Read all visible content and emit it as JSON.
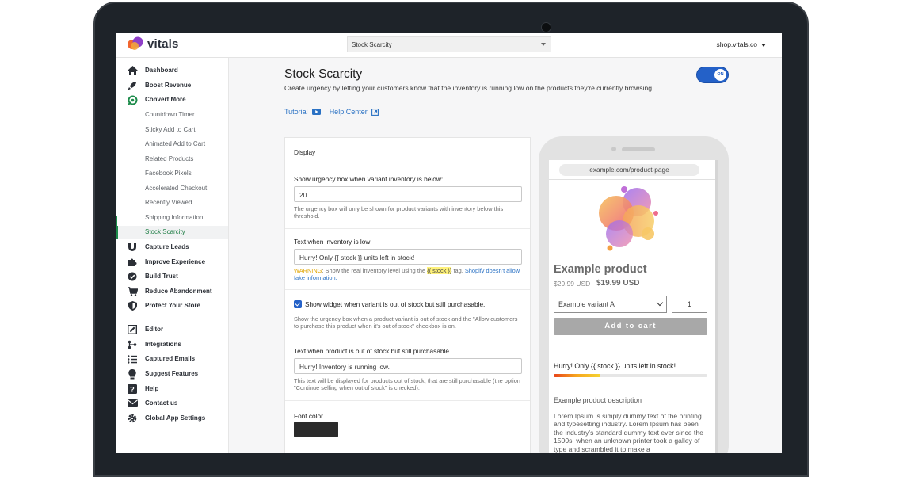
{
  "app": {
    "logo_text": "vitals",
    "page_selector": "Stock Scarcity",
    "store": "shop.vitals.co"
  },
  "sidebar": {
    "items": [
      {
        "label": "Dashboard",
        "icon": "home-icon"
      },
      {
        "label": "Boost Revenue",
        "icon": "rocket-icon"
      },
      {
        "label": "Convert More",
        "icon": "convert-icon"
      },
      {
        "label": "Countdown Timer"
      },
      {
        "label": "Sticky Add to Cart"
      },
      {
        "label": "Animated Add to Cart"
      },
      {
        "label": "Related Products"
      },
      {
        "label": "Facebook Pixels"
      },
      {
        "label": "Accelerated Checkout"
      },
      {
        "label": "Recently Viewed"
      },
      {
        "label": "Shipping Information"
      },
      {
        "label": "Stock Scarcity",
        "active": true
      },
      {
        "label": "Capture Leads",
        "icon": "magnet-icon"
      },
      {
        "label": "Improve Experience",
        "icon": "puzzle-icon"
      },
      {
        "label": "Build Trust",
        "icon": "badge-check-icon"
      },
      {
        "label": "Reduce Abandonment",
        "icon": "cart-icon"
      },
      {
        "label": "Protect Your Store",
        "icon": "shield-icon"
      },
      {
        "label": "Editor",
        "icon": "edit-icon"
      },
      {
        "label": "Integrations",
        "icon": "integrations-icon"
      },
      {
        "label": "Captured Emails",
        "icon": "list-icon"
      },
      {
        "label": "Suggest Features",
        "icon": "lightbulb-icon"
      },
      {
        "label": "Help",
        "icon": "help-icon"
      },
      {
        "label": "Contact us",
        "icon": "mail-icon"
      },
      {
        "label": "Global App Settings",
        "icon": "gear-icon"
      }
    ]
  },
  "main": {
    "title": "Stock Scarcity",
    "description": "Create urgency by letting your customers know that the inventory is running low on the products they're currently browsing.",
    "tutorial_label": "Tutorial",
    "help_center_label": "Help Center",
    "toggle_label": "ON",
    "toggle_on": true
  },
  "form": {
    "section_title": "Display",
    "threshold_label": "Show urgency box when variant inventory is below:",
    "threshold_value": "20",
    "threshold_help": "The urgency box will only be shown for product variants with inventory below this threshold.",
    "low_label": "Text when inventory is low",
    "low_value": "Hurry! Only {{ stock }}  units left in stock!",
    "warn_prefix": "WARNING",
    "warn_text_a": ": Show the real inventory level using the ",
    "warn_token": "{{ stock }}",
    "warn_text_b": " tag, ",
    "warn_link": "Shopify doesn't allow fake information.",
    "oos_checkbox_label": "Show widget when variant is out of stock but still purchasable.",
    "oos_checkbox_checked": true,
    "oos_help": "Show the urgency box when a product variant is out of stock and the \"Allow customers to purchase this product when it's out of stock\" checkbox is on.",
    "oos_text_label": "Text when product is out of stock but still purchasable.",
    "oos_text_value": "Hurry! Inventory is running low.",
    "oos_text_help": "This text will be displayed for products out of stock, that are still purchasable (the option \"Continue selling when out of stock\" is checked).",
    "font_color_label": "Font color",
    "font_color": "#2b2b2b"
  },
  "preview": {
    "url": "example.com/product-page",
    "product_title": "Example product",
    "old_price": "$29.99 USD",
    "new_price": "$19.99 USD",
    "variant": "Example variant A",
    "quantity": "1",
    "add_to_cart": "Add to cart",
    "urgency_text": "Hurry! Only {{ stock }} units left in stock!",
    "stock_fill_fraction": 0.3,
    "description_heading": "Example product description",
    "description": "Lorem Ipsum is simply dummy text of the printing and typesetting industry. Lorem Ipsum has been the industry's standard dummy text ever since the 1500s, when an unknown printer took a galley of type and scrambled it to make a"
  },
  "colors": {
    "accent": "#2461c8",
    "active_green": "#1c8b4a",
    "link": "#2b72c4"
  }
}
